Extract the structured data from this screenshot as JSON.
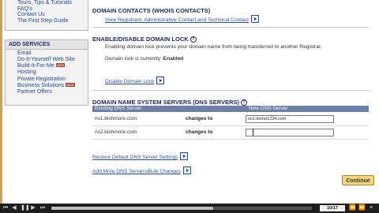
{
  "sidebar": {
    "top_links": [
      "Tours, Tips & Tutorials",
      "FAQ's",
      "Contact Us",
      "The First Step Guide"
    ],
    "add_services": {
      "heading": "ADD SERVICES",
      "items": [
        {
          "label": "Email",
          "badge": ""
        },
        {
          "label": "Do-It-Yourself Web Site",
          "badge": ""
        },
        {
          "label": "Build-It-For-Me",
          "badge": "NEW"
        },
        {
          "label": "Hosting",
          "badge": ""
        },
        {
          "label": "Private Registration",
          "badge": ""
        },
        {
          "label": "Business Solutions",
          "badge": "NEW"
        },
        {
          "label": "Partner Offers",
          "badge": ""
        }
      ]
    }
  },
  "domain_contacts": {
    "title": "DOMAIN CONTACTS (WHOIS CONTACTS)",
    "link": "View Registrant, Administrative Contact and Technical Contact"
  },
  "domain_lock": {
    "title": "ENABLE/DISABLE DOMAIN LOCK",
    "description": "Enabling domain lock prevents your domain name from being transferred to another Registrar.",
    "status_label": "Domain lock is currently:",
    "status_value": "Enabled",
    "link": "Disable Domain Lock"
  },
  "dns": {
    "title": "DOMAIN NAME SYSTEM SERVERS (DNS SERVERS)",
    "columns": [
      "Existing DNS Server",
      "New DNS Server"
    ],
    "rows": [
      {
        "existing": "ns1.bishmore.com",
        "action": "changes to",
        "new_value": "ns1.demo1234.com"
      },
      {
        "existing": "ns2.bishmore.com",
        "action": "changes to",
        "new_value": ""
      }
    ],
    "restore_link": "Restore Default DNS Server Settings",
    "add_more_link": "Add More DNS Servers/Bulk Changes"
  },
  "continue_label": "Continue",
  "player": {
    "counter": "10/17",
    "progress": 0.62
  },
  "colors": {
    "accent_link": "#2a4ea8",
    "header_bar": "#6d7fa4",
    "button_gold": "#f4d47a"
  }
}
